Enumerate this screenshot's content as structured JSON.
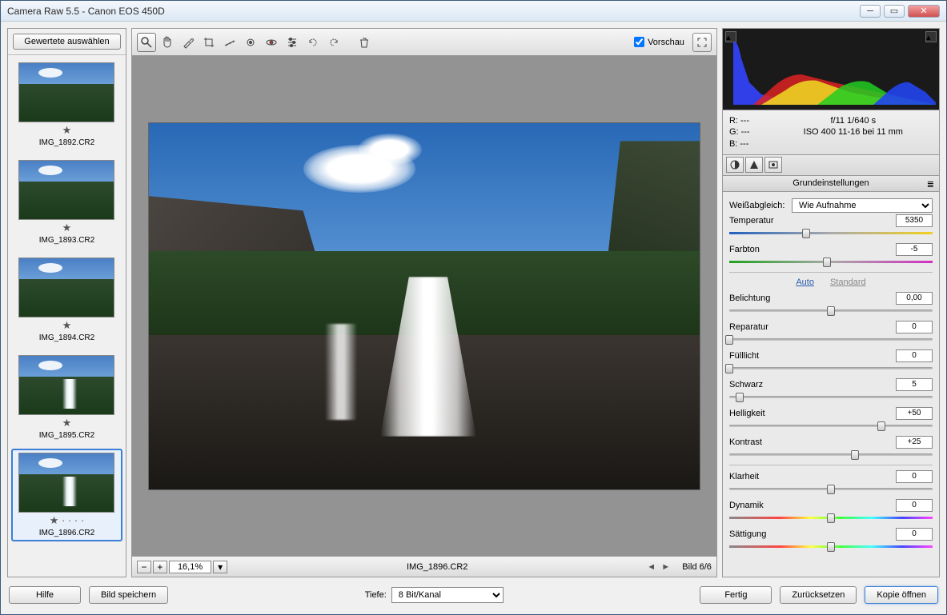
{
  "window_title": "Camera Raw 5.5 - Canon EOS 450D",
  "filmstrip": {
    "select_rated_btn": "Gewertete auswählen",
    "items": [
      {
        "name": "IMG_1892.CR2",
        "selected": false,
        "waterfall": false
      },
      {
        "name": "IMG_1893.CR2",
        "selected": false,
        "waterfall": false
      },
      {
        "name": "IMG_1894.CR2",
        "selected": false,
        "waterfall": false
      },
      {
        "name": "IMG_1895.CR2",
        "selected": false,
        "waterfall": true
      },
      {
        "name": "IMG_1896.CR2",
        "selected": true,
        "waterfall": true
      }
    ]
  },
  "toolbar": {
    "preview_label": "Vorschau",
    "preview_checked": true
  },
  "statusbar": {
    "zoom": "16,1%",
    "filename": "IMG_1896.CR2",
    "position": "Bild 6/6"
  },
  "exif": {
    "r": "R:   ---",
    "g": "G:   ---",
    "b": "B:   ---",
    "line1": "f/11    1/640 s",
    "line2": "ISO 400    11-16 bei 11 mm"
  },
  "panel": {
    "header": "Grundeinstellungen",
    "wb_label": "Weißabgleich:",
    "wb_value": "Wie Aufnahme",
    "auto": "Auto",
    "standard": "Standard",
    "sliders": {
      "temp": {
        "label": "Temperatur",
        "value": "5350",
        "pos": 38,
        "grad": "grad-temp"
      },
      "tint": {
        "label": "Farbton",
        "value": "-5",
        "pos": 48,
        "grad": "grad-tint"
      },
      "expo": {
        "label": "Belichtung",
        "value": "0,00",
        "pos": 50
      },
      "recov": {
        "label": "Reparatur",
        "value": "0",
        "pos": 0
      },
      "fill": {
        "label": "Fülllicht",
        "value": "0",
        "pos": 0
      },
      "black": {
        "label": "Schwarz",
        "value": "5",
        "pos": 5
      },
      "bright": {
        "label": "Helligkeit",
        "value": "+50",
        "pos": 75
      },
      "contr": {
        "label": "Kontrast",
        "value": "+25",
        "pos": 62
      },
      "clar": {
        "label": "Klarheit",
        "value": "0",
        "pos": 50
      },
      "vib": {
        "label": "Dynamik",
        "value": "0",
        "pos": 50,
        "grad": "grad-vib"
      },
      "sat": {
        "label": "Sättigung",
        "value": "0",
        "pos": 50,
        "grad": "grad-vib"
      }
    }
  },
  "bottom": {
    "help": "Hilfe",
    "save": "Bild speichern",
    "depth_label": "Tiefe:",
    "depth_value": "8 Bit/Kanal",
    "done": "Fertig",
    "reset": "Zurücksetzen",
    "open": "Kopie öffnen"
  }
}
